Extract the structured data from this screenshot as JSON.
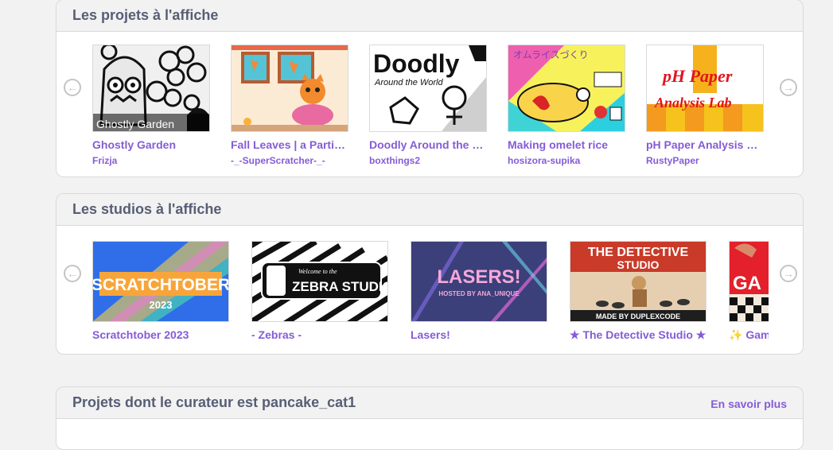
{
  "featured_projects": {
    "title": "Les projets à l'affiche",
    "items": [
      {
        "title": "Ghostly Garden",
        "author": "Frizja",
        "thumb_text": "Ghostly Garden"
      },
      {
        "title": "Fall Leaves | a Particle Engine",
        "author": "-_-SuperScratcher-_-"
      },
      {
        "title": "Doodly Around the World",
        "author": "boxthings2",
        "thumb_text": "Doodly",
        "thumb_subtext": "Around the World"
      },
      {
        "title": "Making omelet rice",
        "author": "hosizora-supika",
        "thumb_text": "オムライスづくり"
      },
      {
        "title": "pH Paper Analysis Lab",
        "author": "RustyPaper",
        "thumb_text": "pH Paper",
        "thumb_subtext": "Analysis Lab"
      }
    ]
  },
  "featured_studios": {
    "title": "Les studios à l'affiche",
    "items": [
      {
        "title": "Scratchtober 2023",
        "thumb_text": "SCRATCHTOBER",
        "thumb_subtext": "2023"
      },
      {
        "title": "- Zebras -",
        "thumb_text": "ZEBRA STUDIO",
        "thumb_subtext": "Welcome to the"
      },
      {
        "title": "Lasers!",
        "thumb_text": "LASERS!",
        "thumb_subtext": "HOSTED BY ANA_UNIQUE"
      },
      {
        "title": "★ The Detective Studio ★",
        "thumb_text": "THE DETECTIVE",
        "thumb_subtext": "STUDIO",
        "thumb_footer": "MADE BY DUPLEXCODE"
      },
      {
        "title": "✨ Games ✨",
        "thumb_text": "GA"
      }
    ]
  },
  "curated": {
    "title": "Projets dont le curateur est pancake_cat1",
    "more_label": "En savoir plus"
  },
  "icons": {
    "prev": "←",
    "next": "→"
  },
  "colors": {
    "link": "#855cd6",
    "heading": "#575e75",
    "border": "#d9d9d9",
    "background": "#f2f2f2"
  }
}
